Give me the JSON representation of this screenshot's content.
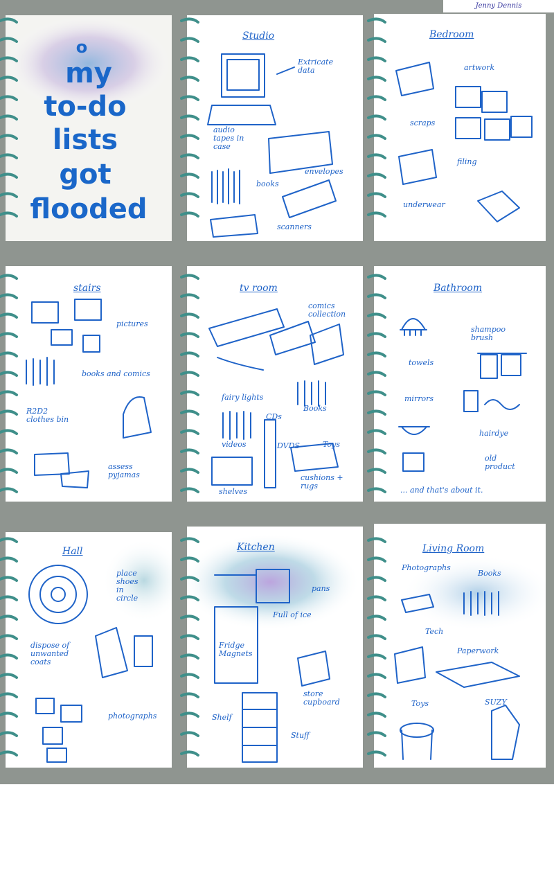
{
  "credit": "Jenny Dennis",
  "cover": {
    "lines": [
      "o",
      "my",
      "to-do",
      "lists",
      "got",
      "flooded"
    ]
  },
  "pages": {
    "studio": {
      "title": "Studio",
      "labels": [
        "Extricate\ndata",
        "audio\ntapes in\ncase",
        "books",
        "envelopes",
        "scanners"
      ]
    },
    "bedroom": {
      "title": "Bedroom",
      "labels": [
        "artwork",
        "scraps",
        "filing",
        "underwear"
      ]
    },
    "stairs": {
      "title": "stairs",
      "labels": [
        "pictures",
        "books and comics",
        "R2D2\nclothes bin",
        "assess\npyjamas"
      ]
    },
    "tvroom": {
      "title": "tv room",
      "labels": [
        "comics\ncollection",
        "fairy lights",
        "Books",
        "CDs",
        "videos",
        "DVDS",
        "Toys",
        "shelves",
        "cushions +\nrugs"
      ]
    },
    "bathroom": {
      "title": "Bathroom",
      "labels": [
        "shampoo\nbrush",
        "towels",
        "mirrors",
        "hairdye",
        "old\nproduct",
        "... and that's about it."
      ]
    },
    "hall": {
      "title": "Hall",
      "labels": [
        "place\nshoes\nin\ncircle",
        "dispose of\nunwanted\ncoats",
        "photographs"
      ]
    },
    "kitchen": {
      "title": "Kitchen",
      "labels": [
        "pans",
        "Full of ice",
        "Fridge\nMagnets",
        "store\ncupboard",
        "Shelf",
        "Stuff"
      ]
    },
    "livingroom": {
      "title": "Living Room",
      "labels": [
        "Photographs",
        "Books",
        "Tech",
        "Paperwork",
        "Toys",
        "SUZY"
      ]
    }
  }
}
